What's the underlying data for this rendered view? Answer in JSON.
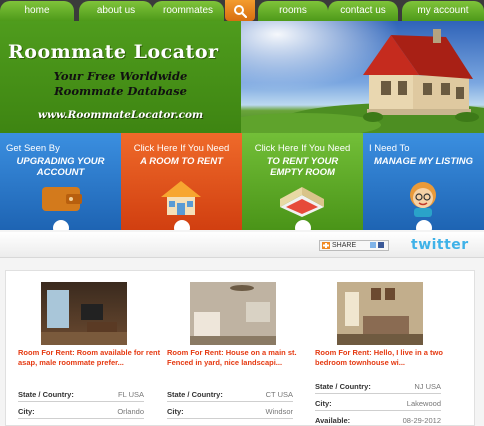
{
  "nav": {
    "items": [
      "home",
      "about us",
      "roommates",
      "rooms",
      "contact us",
      "my account"
    ],
    "search_icon": "search-icon"
  },
  "banner": {
    "title": "Roommate Locator",
    "subtitle_1": "Your Free Worldwide",
    "subtitle_2": "Roommate Database",
    "url": "www.RoommateLocator.com"
  },
  "features": [
    {
      "line1": "Get Seen By",
      "line2": "UPGRADING YOUR ACCOUNT",
      "color": "#2a7fd1"
    },
    {
      "line1": "Click Here If You Need",
      "line2": "A ROOM TO RENT",
      "color": "#e2521a"
    },
    {
      "line1": "Click Here If You Need",
      "line2": "TO RENT YOUR EMPTY ROOM",
      "color": "#59a828"
    },
    {
      "line1": "I Need To",
      "line2": "MANAGE MY LISTING",
      "color": "#2a7fd1"
    }
  ],
  "share": {
    "label": "SHARE",
    "twitter": "twitter"
  },
  "listings": [
    {
      "title": "Room For Rent: Room available for rent asap, male roommate prefer...",
      "state_label": "State / Country:",
      "state_value": "FL  USA",
      "city_label": "City:",
      "city_value": "Orlando"
    },
    {
      "title": "Room For Rent: House on a main st. Fenced in yard, nice landscapi...",
      "state_label": "State / Country:",
      "state_value": "CT  USA",
      "city_label": "City:",
      "city_value": "Windsor"
    },
    {
      "title": "Room For Rent: Hello, I live in a two bedroom townhouse wi...",
      "state_label": "State / Country:",
      "state_value": "NJ  USA",
      "city_label": "City:",
      "city_value": "Lakewood",
      "avail_label": "Available:",
      "avail_value": "08-29-2012"
    }
  ]
}
